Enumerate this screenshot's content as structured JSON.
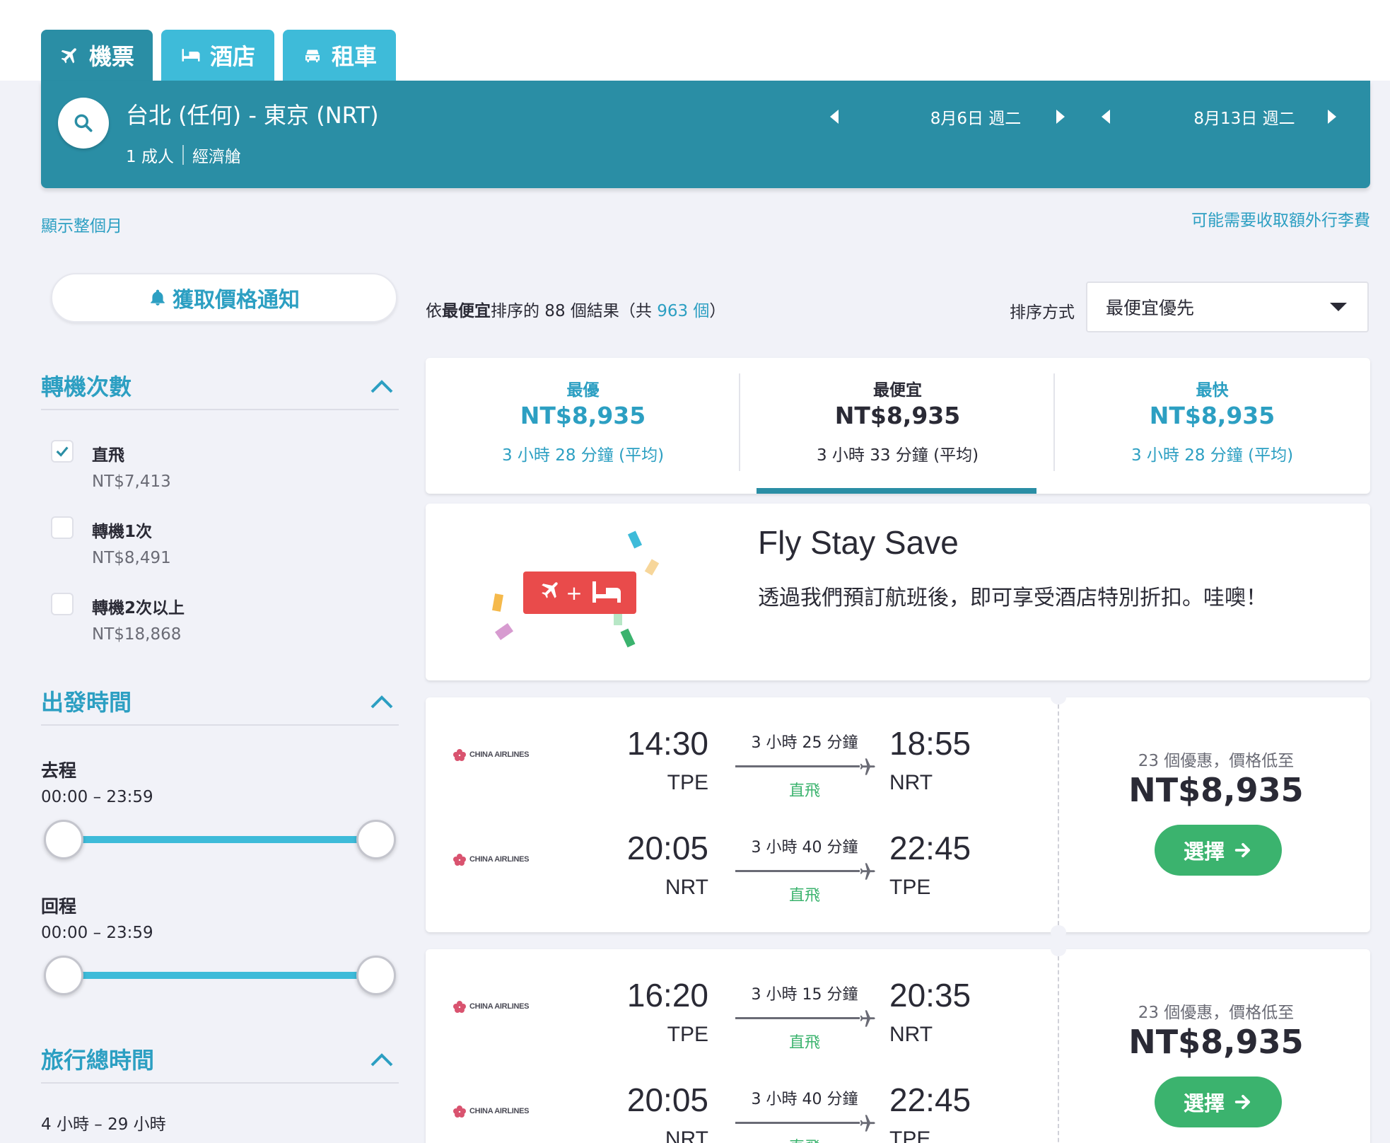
{
  "tabs": [
    {
      "label": "機票",
      "icon": "plane-icon",
      "active": true
    },
    {
      "label": "酒店",
      "icon": "bed-icon",
      "active": false
    },
    {
      "label": "租車",
      "icon": "car-icon",
      "active": false
    }
  ],
  "search": {
    "route": "台北 (任何) - 東京 (NRT)",
    "passengers": "1 成人",
    "cabin": "經濟艙",
    "depart_date": "8月6日 週二",
    "return_date": "8月13日 週二"
  },
  "links": {
    "show_month": "顯示整個月",
    "baggage_fee": "可能需要收取額外行李費"
  },
  "alert_button": "獲取價格通知",
  "filters": {
    "stops": {
      "title": "轉機次數",
      "options": [
        {
          "label": "直飛",
          "price": "NT$7,413",
          "checked": true
        },
        {
          "label": "轉機1次",
          "price": "NT$8,491",
          "checked": false
        },
        {
          "label": "轉機2次以上",
          "price": "NT$18,868",
          "checked": false
        }
      ]
    },
    "departure_time": {
      "title": "出發時間",
      "outbound_label": "去程",
      "outbound_range": "00:00 – 23:59",
      "return_label": "回程",
      "return_range": "00:00 – 23:59"
    },
    "total_time": {
      "title": "旅行總時間",
      "range": "4 小時 – 29 小時"
    }
  },
  "results": {
    "prefix": "依",
    "sort_word": "最便宜",
    "middle": "排序的 88 個結果（共 ",
    "total": "963 個",
    "suffix": "）"
  },
  "sort": {
    "label": "排序方式",
    "selected": "最便宜優先"
  },
  "summary": [
    {
      "title": "最優",
      "price": "NT$8,935",
      "duration": "3 小時 28 分鐘 (平均)",
      "highlight": true
    },
    {
      "title": "最便宜",
      "price": "NT$8,935",
      "duration": "3 小時 33 分鐘 (平均)",
      "highlight": false
    },
    {
      "title": "最快",
      "price": "NT$8,935",
      "duration": "3 小時 28 分鐘 (平均)",
      "highlight": true
    }
  ],
  "promo": {
    "title": "Fly Stay Save",
    "text": "透過我們預訂航班後，即可享受酒店特別折扣。哇噢！"
  },
  "flights": [
    {
      "legs": [
        {
          "airline": "CHINA AIRLINES",
          "dep_time": "14:30",
          "dep_airport": "TPE",
          "duration": "3 小時 25 分鐘",
          "stops": "直飛",
          "arr_time": "18:55",
          "arr_airport": "NRT"
        },
        {
          "airline": "CHINA AIRLINES",
          "dep_time": "20:05",
          "dep_airport": "NRT",
          "duration": "3 小時 40 分鐘",
          "stops": "直飛",
          "arr_time": "22:45",
          "arr_airport": "TPE"
        }
      ],
      "offers": "23 個優惠，價格低至",
      "price": "NT$8,935",
      "button": "選擇"
    },
    {
      "legs": [
        {
          "airline": "CHINA AIRLINES",
          "dep_time": "16:20",
          "dep_airport": "TPE",
          "duration": "3 小時 15 分鐘",
          "stops": "直飛",
          "arr_time": "20:35",
          "arr_airport": "NRT"
        },
        {
          "airline": "CHINA AIRLINES",
          "dep_time": "20:05",
          "dep_airport": "NRT",
          "duration": "3 小時 40 分鐘",
          "stops": "直飛",
          "arr_time": "22:45",
          "arr_airport": "TPE"
        }
      ],
      "offers": "23 個優惠，價格低至",
      "price": "NT$8,935",
      "button": "選擇"
    }
  ],
  "colors": {
    "primary": "#2a8ea5",
    "accent": "#3ebbd9",
    "link": "#2c9fc2",
    "green": "#3bb36e",
    "promo_red": "#e94b4b"
  }
}
